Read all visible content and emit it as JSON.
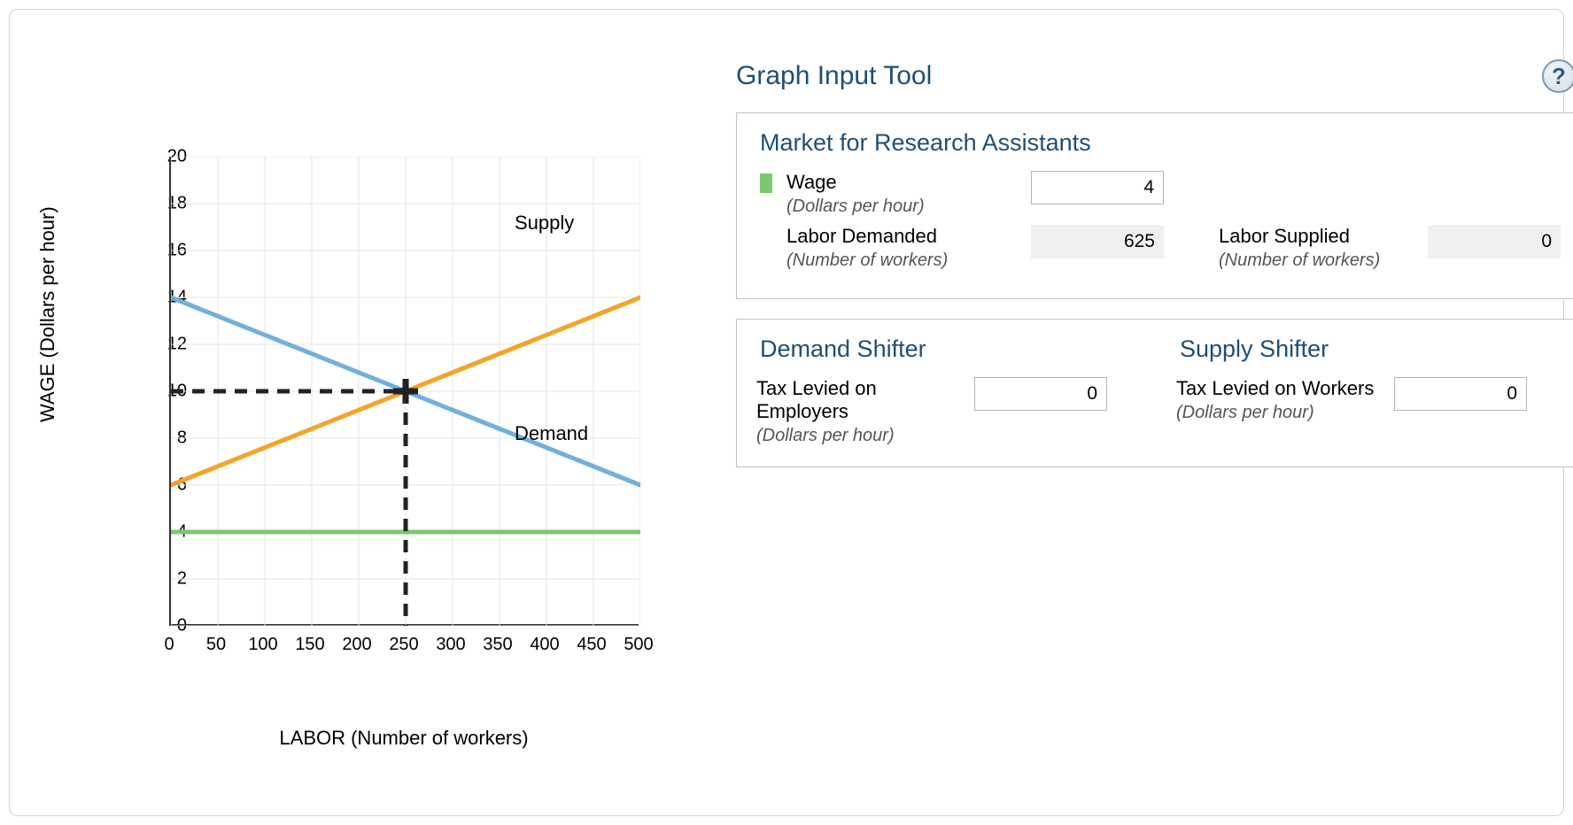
{
  "tool_title": "Graph Input Tool",
  "help_glyph": "?",
  "market_box": {
    "title": "Market for Research Assistants",
    "wage_label": "Wage",
    "wage_sub": "(Dollars per hour)",
    "wage_value": "4",
    "demanded_label": "Labor Demanded",
    "demanded_sub": "(Number of workers)",
    "demanded_value": "625",
    "supplied_label": "Labor Supplied",
    "supplied_sub": "(Number of workers)",
    "supplied_value": "0"
  },
  "shifter_box": {
    "demand_title": "Demand Shifter",
    "supply_title": "Supply Shifter",
    "demand_label": "Tax Levied on Employers",
    "demand_sub": "(Dollars per hour)",
    "demand_value": "0",
    "supply_label": "Tax Levied on Workers",
    "supply_sub": "(Dollars per hour)",
    "supply_value": "0"
  },
  "chart_data": {
    "type": "line",
    "xlabel": "LABOR (Number of workers)",
    "ylabel": "WAGE (Dollars per hour)",
    "xlim": [
      0,
      500
    ],
    "ylim": [
      0,
      20
    ],
    "x_ticks": [
      0,
      50,
      100,
      150,
      200,
      250,
      300,
      350,
      400,
      450,
      500
    ],
    "y_ticks": [
      0,
      2,
      4,
      6,
      8,
      10,
      12,
      14,
      16,
      18,
      20
    ],
    "series": [
      {
        "name": "Demand",
        "color": "#6fb0dd",
        "points": [
          [
            0,
            14
          ],
          [
            500,
            6
          ]
        ]
      },
      {
        "name": "Supply",
        "color": "#f6a32a",
        "points": [
          [
            0,
            6
          ],
          [
            500,
            14
          ]
        ]
      },
      {
        "name": "Wage",
        "color": "#7bc96f",
        "points": [
          [
            0,
            4
          ],
          [
            500,
            4
          ]
        ]
      }
    ],
    "equilibrium": {
      "x": 250,
      "y": 10
    },
    "series_labels": {
      "supply": "Supply",
      "demand": "Demand"
    }
  }
}
